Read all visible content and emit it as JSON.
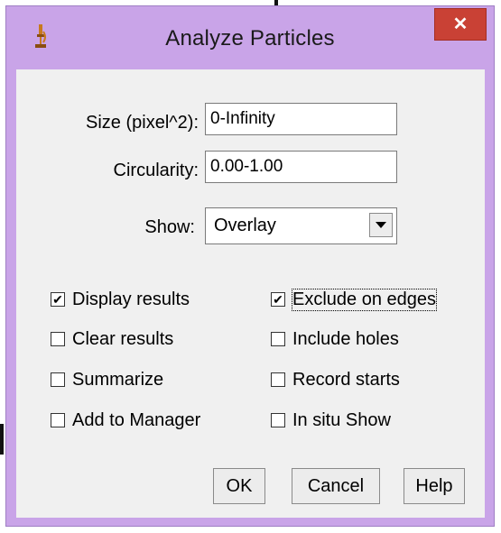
{
  "window": {
    "title": "Analyze Particles",
    "close_label": "✕"
  },
  "fields": {
    "size_label": "Size (pixel^2):",
    "size_value": "0-Infinity",
    "circularity_label": "Circularity:",
    "circularity_value": "0.00-1.00",
    "show_label": "Show:",
    "show_value": "Overlay"
  },
  "checkboxes_left": [
    {
      "label": "Display results",
      "checked": true
    },
    {
      "label": "Clear results",
      "checked": false
    },
    {
      "label": "Summarize",
      "checked": false
    },
    {
      "label": "Add to Manager",
      "checked": false
    }
  ],
  "checkboxes_right": [
    {
      "label": "Exclude on edges",
      "checked": true
    },
    {
      "label": "Include holes",
      "checked": false
    },
    {
      "label": "Record starts",
      "checked": false
    },
    {
      "label": "In situ Show",
      "checked": false
    }
  ],
  "buttons": {
    "ok": "OK",
    "cancel": "Cancel",
    "help": "Help"
  },
  "check_mark": "✔"
}
